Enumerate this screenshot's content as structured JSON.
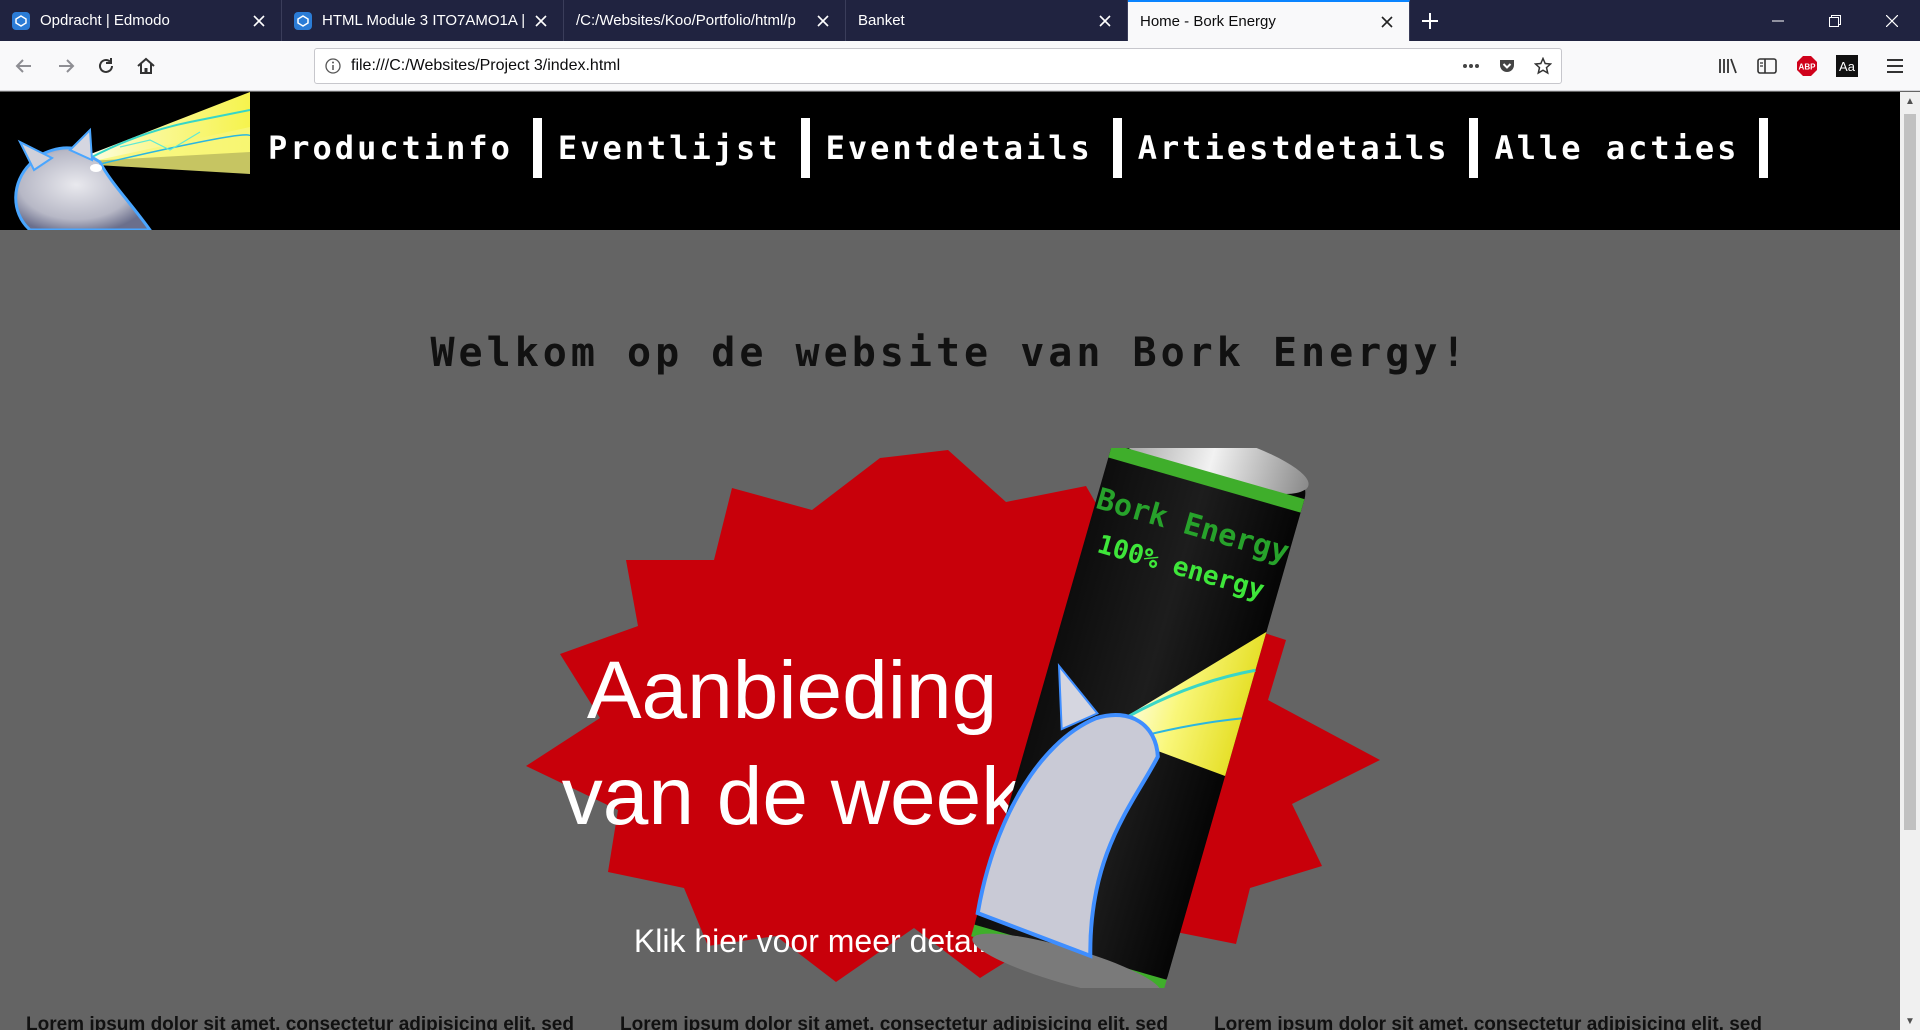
{
  "browser": {
    "tabs": [
      {
        "title": "Opdracht | Edmodo",
        "favicon": "edmodo-icon"
      },
      {
        "title": "HTML Module 3 ITO7AMO1A |",
        "favicon": "edmodo-icon"
      },
      {
        "title": "/C:/Websites/Koo/Portfolio/html/p",
        "favicon": "none"
      },
      {
        "title": "Banket",
        "favicon": "none"
      },
      {
        "title": "Home - Bork Energy",
        "favicon": "none",
        "active": true
      }
    ],
    "url": "file:///C:/Websites/Project 3/index.html"
  },
  "site": {
    "menu": [
      "Productinfo",
      "Eventlijst",
      "Eventdetails",
      "Artiestdetails",
      "Alle acties"
    ],
    "welcome": "Welkom op de website van Bork Energy!",
    "offer": {
      "line1": "Aanbieding",
      "line2": "van de week",
      "cta": "Klik hier voor meer details",
      "can_brand": "Bork Energy",
      "can_tagline": "100% energy"
    },
    "columns": [
      "Lorem ipsum dolor sit amet, consectetur adipisicing elit, sed",
      "Lorem ipsum dolor sit amet, consectetur adipisicing elit, sed",
      "Lorem ipsum dolor sit amet, consectetur adipisicing elit, sed"
    ],
    "colors": {
      "page_bg": "#646464",
      "header_bg": "#000000",
      "burst": "#c8000a",
      "accent_tab": "#0a84ff"
    }
  }
}
